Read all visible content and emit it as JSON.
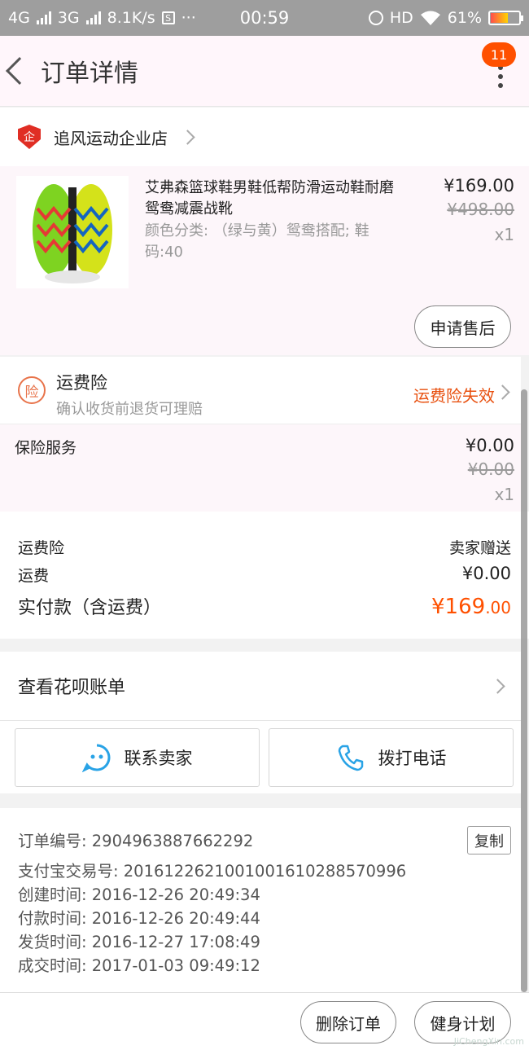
{
  "status_bar": {
    "network1": "4G",
    "network2": "3G",
    "speed": "8.1K/s",
    "dots": "···",
    "time": "00:59",
    "hd": "HD",
    "battery_pct": "61%"
  },
  "nav": {
    "title": "订单详情",
    "badge_count": "11"
  },
  "store": {
    "name": "追风运动企业店",
    "icon_char": "企"
  },
  "product": {
    "title": "艾弗森篮球鞋男鞋低帮防滑运动鞋耐磨鸳鸯减震战靴",
    "spec": "颜色分类: （绿与黄）鸳鸯搭配; 鞋码:40",
    "price": "¥169.00",
    "original_price": "¥498.00",
    "quantity": "x1",
    "after_sale_label": "申请售后"
  },
  "freight_insurance": {
    "icon_char": "险",
    "title": "运费险",
    "subtitle": "确认收货前退货可理赔",
    "status": "运费险失效"
  },
  "insurance_service": {
    "label": "保险服务",
    "price": "¥0.00",
    "original_price": "¥0.00",
    "quantity": "x1"
  },
  "summary": {
    "freight_ins_label": "运费险",
    "freight_ins_value": "卖家赠送",
    "shipping_label": "运费",
    "shipping_value": "¥0.00",
    "total_label": "实付款（含运费）",
    "total_main": "¥169",
    "total_decimal": ".00"
  },
  "huabei": {
    "label": "查看花呗账单"
  },
  "actions": {
    "contact_seller": "联系卖家",
    "call_phone": "拨打电话"
  },
  "order_info": {
    "copy_label": "复制",
    "lines": [
      "订单编号: 2904963887662292",
      "支付宝交易号: 2016122621001001610288570996",
      "创建时间: 2016-12-26 20:49:34",
      "付款时间: 2016-12-26 20:49:44",
      "发货时间: 2016-12-27 17:08:49",
      "成交时间: 2017-01-03 09:49:12"
    ]
  },
  "footer": {
    "delete_order": "删除订单",
    "fitness_plan": "健身计划",
    "watermark": "JiChengXin.com"
  },
  "colors": {
    "accent": "#ff5000",
    "status_orange": "#e8500f",
    "status_bar": "#9e9e9e"
  },
  "icons": {
    "back": "chevron-left-icon",
    "more": "more-vertical-icon",
    "store": "enterprise-shield-icon",
    "insurance": "insurance-icon",
    "chat": "chat-face-icon",
    "phone": "phone-icon"
  }
}
